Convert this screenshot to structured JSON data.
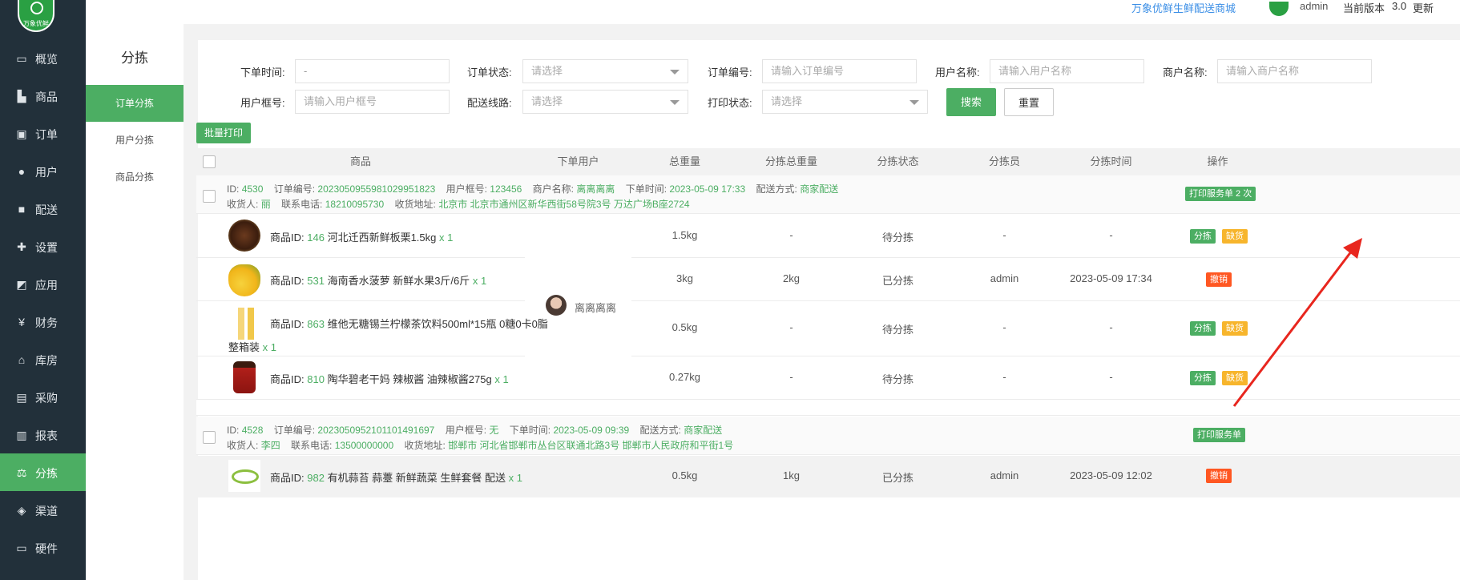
{
  "brand": {
    "logo_text": "万象优鲜",
    "colors": {
      "accent": "#4cae63",
      "sidebar": "#22303a",
      "danger": "#ff5722",
      "warning": "#f7b52c"
    }
  },
  "nav": [
    {
      "label": "概览",
      "icon": "monitor-icon"
    },
    {
      "label": "商品",
      "icon": "cart-icon"
    },
    {
      "label": "订单",
      "icon": "order-icon"
    },
    {
      "label": "用户",
      "icon": "users-icon"
    },
    {
      "label": "配送",
      "icon": "truck-icon"
    },
    {
      "label": "设置",
      "icon": "puzzle-icon"
    },
    {
      "label": "应用",
      "icon": "app-icon"
    },
    {
      "label": "财务",
      "icon": "yen-icon"
    },
    {
      "label": "库房",
      "icon": "home-icon"
    },
    {
      "label": "采购",
      "icon": "bus-icon"
    },
    {
      "label": "报表",
      "icon": "bar-chart-icon"
    },
    {
      "label": "分拣",
      "icon": "scale-icon"
    },
    {
      "label": "渠道",
      "icon": "cube-icon"
    },
    {
      "label": "硬件",
      "icon": "desktop-icon"
    }
  ],
  "subnav": {
    "title": "分拣",
    "items": [
      "订单分拣",
      "用户分拣",
      "商品分拣"
    ]
  },
  "topbar": {
    "shop_link": "万象优鲜生鲜配送商城",
    "user": "admin",
    "version_label": "当前版本",
    "version": "3.0",
    "update": "更新"
  },
  "filters": {
    "order_time_label": "下单时间:",
    "order_time_value": "-",
    "order_status_label": "订单状态:",
    "order_status_placeholder": "请选择",
    "order_no_label": "订单编号:",
    "order_no_placeholder": "请输入订单编号",
    "user_name_label": "用户名称:",
    "user_name_placeholder": "请输入用户名称",
    "merchant_label": "商户名称:",
    "merchant_placeholder": "请输入商户名称",
    "user_frame_label": "用户框号:",
    "user_frame_placeholder": "请输入用户框号",
    "route_label": "配送线路:",
    "route_placeholder": "请选择",
    "print_status_label": "打印状态:",
    "print_status_placeholder": "请选择",
    "search": "搜索",
    "reset": "重置"
  },
  "batch_print": "批量打印",
  "table_headers": [
    "商品",
    "下单用户",
    "总重量",
    "分拣总重量",
    "分拣状态",
    "分拣员",
    "分拣时间",
    "操作"
  ],
  "labels": {
    "id": "ID:",
    "order_no": "订单编号:",
    "user_frame": "用户框号:",
    "merchant": "商户名称:",
    "order_time": "下单时间:",
    "delivery": "配送方式:",
    "receiver": "收货人:",
    "phone": "联系电话:",
    "address": "收货地址:",
    "product_id": "商品ID:"
  },
  "orders": [
    {
      "id": "4530",
      "order_no": "20230509559810299518​23",
      "user_frame": "123456",
      "merchant": "离离离离",
      "order_time": "2023-05-09 17:33",
      "delivery": "商家配送",
      "receiver": "丽",
      "phone": "18210095730",
      "address": "北京市 北京市通州区新华西街58号院3号 万达广场B座2724",
      "print_btn": "打印服务单 2 次",
      "customer": "离离离离",
      "items": [
        {
          "pid": "146",
          "name": "河北迁西新鲜板栗1.5kg",
          "qty": "x 1",
          "weight": "1.5kg",
          "sorted_weight": "-",
          "status": "待分拣",
          "sorter": "-",
          "time": "-",
          "actions": [
            "分拣",
            "缺货"
          ]
        },
        {
          "pid": "531",
          "name": "海南香水菠萝 新鲜水果3斤/6斤",
          "qty": "x 1",
          "weight": "3kg",
          "sorted_weight": "2kg",
          "status": "已分拣",
          "sorter": "admin",
          "time": "2023-05-09 17:34",
          "actions": [
            "撤销"
          ]
        },
        {
          "pid": "863",
          "name": "维他无糖锡兰柠檬茶饮料500ml*15瓶 0糖0卡0脂",
          "name2": "整箱装",
          "qty": "x 1",
          "weight": "0.5kg",
          "sorted_weight": "-",
          "status": "待分拣",
          "sorter": "-",
          "time": "-",
          "actions": [
            "分拣",
            "缺货"
          ]
        },
        {
          "pid": "810",
          "name": "陶华碧老干妈 辣椒酱 油辣椒酱275g",
          "qty": "x 1",
          "weight": "0.27kg",
          "sorted_weight": "-",
          "status": "待分拣",
          "sorter": "-",
          "time": "-",
          "actions": [
            "分拣",
            "缺货"
          ]
        }
      ]
    },
    {
      "id": "4528",
      "order_no": "2023050952101101491697",
      "user_frame": "无",
      "order_time": "2023-05-09 09:39",
      "delivery": "商家配送",
      "receiver": "李四",
      "phone": "13500000000",
      "address": "邯郸市 河北省邯郸市丛台区联通北路3号 邯郸市人民政府和平街1号",
      "print_btn": "打印服务单",
      "items": [
        {
          "pid": "982",
          "name": "有机蒜苔 蒜薹 新鲜蔬菜 生鲜套餐 配送",
          "qty": "x 1",
          "weight": "0.5kg",
          "sorted_weight": "1kg",
          "status": "已分拣",
          "sorter": "admin",
          "time": "2023-05-09 12:02",
          "actions": [
            "撤销"
          ]
        }
      ]
    }
  ]
}
